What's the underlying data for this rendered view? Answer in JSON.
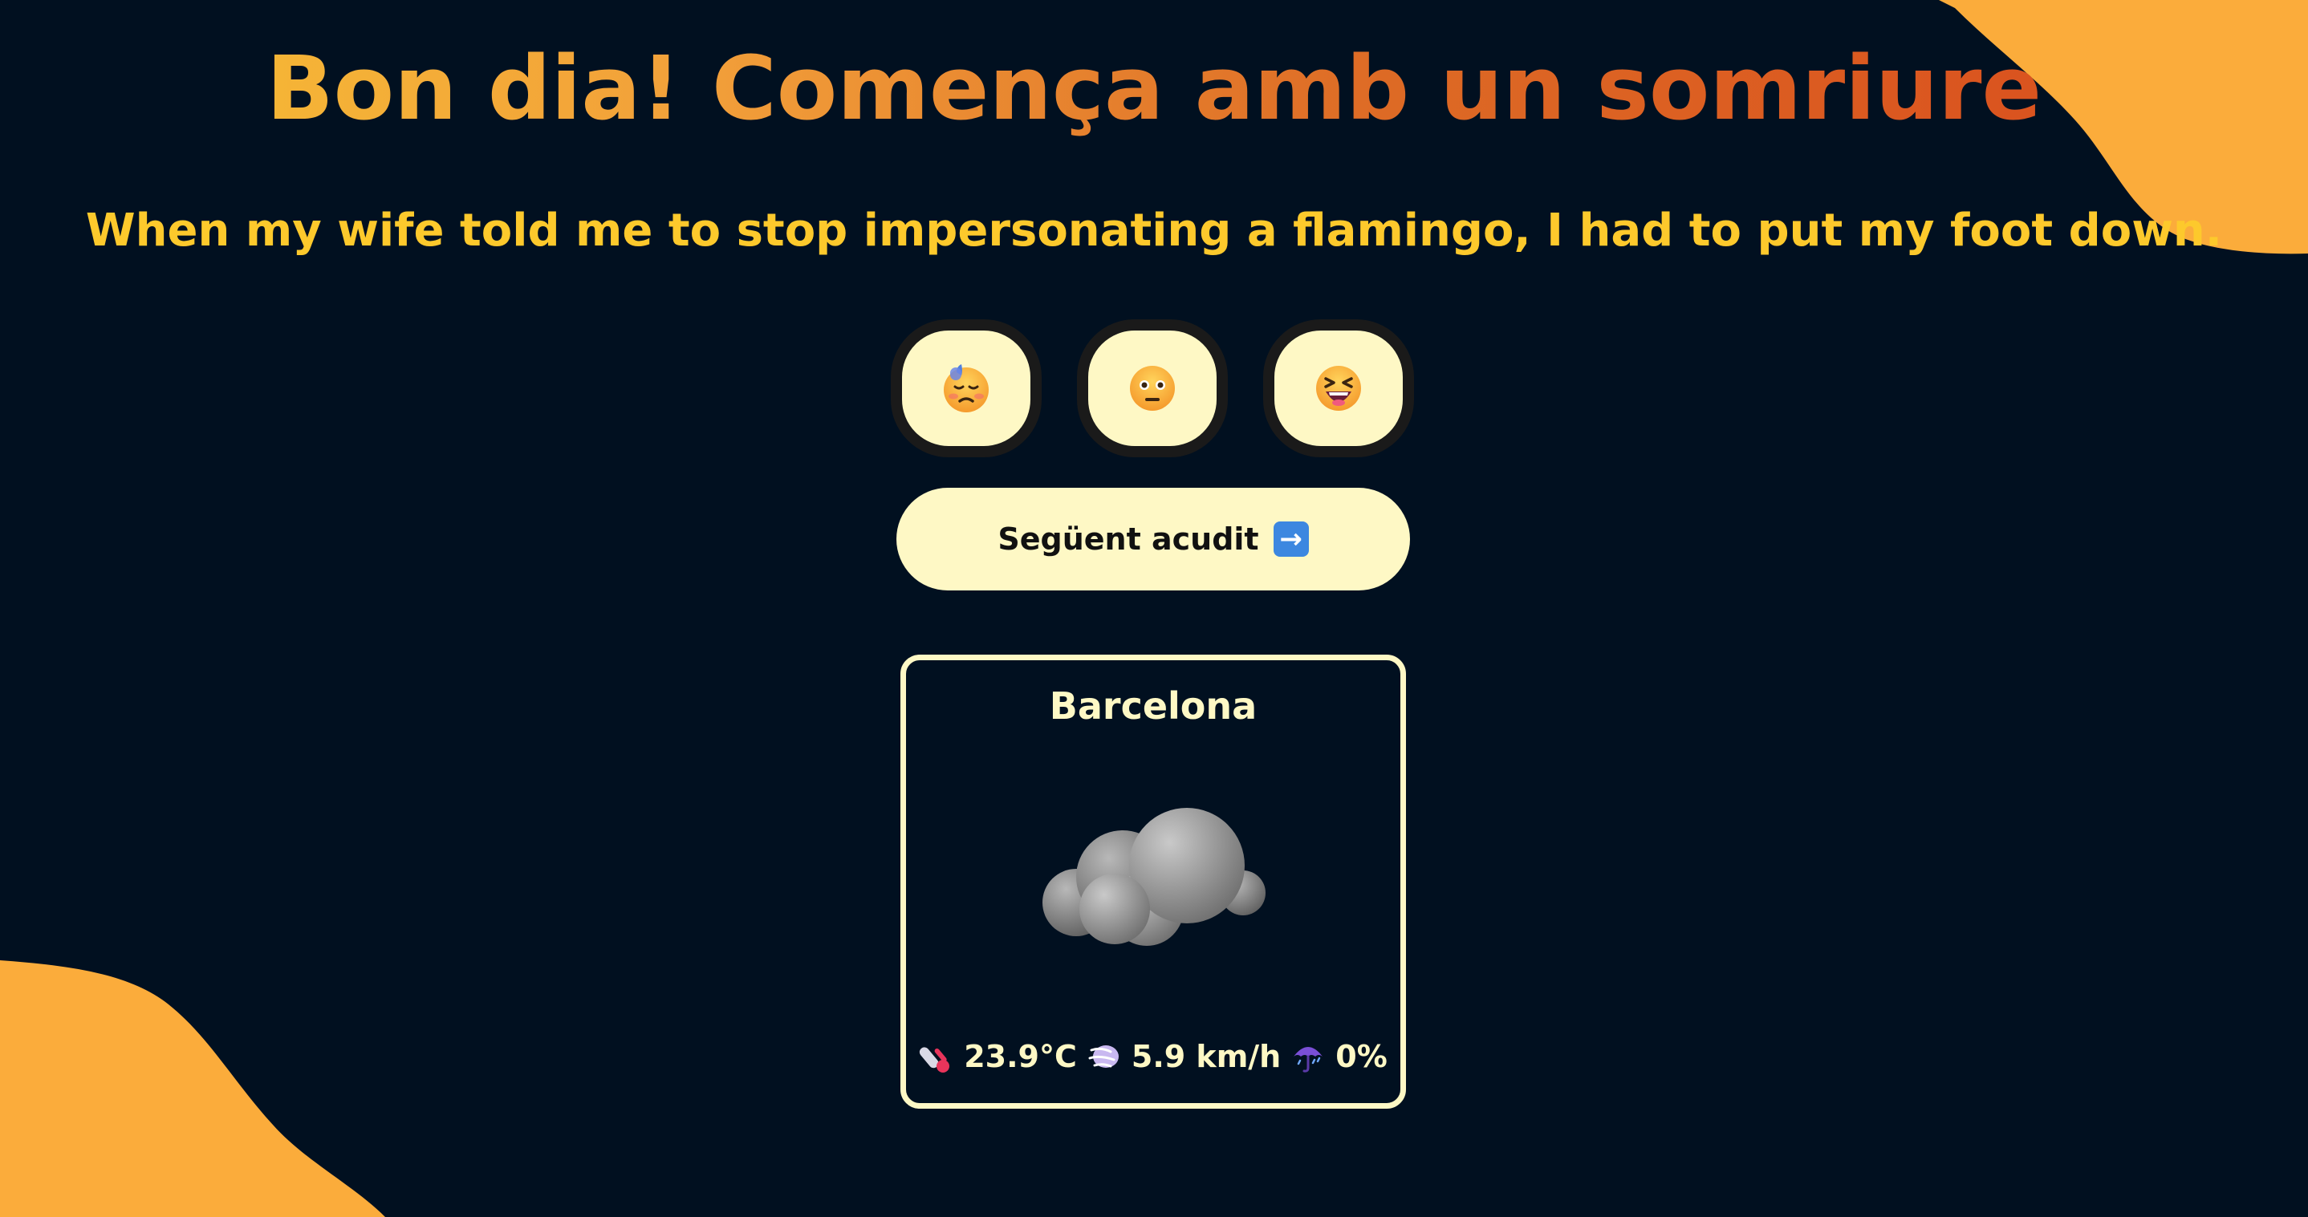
{
  "header": {
    "greeting": "Bon dia!",
    "tagline": "Comença amb un somriure"
  },
  "joke": {
    "text": "When my wife told me to stop impersonating a flamingo, I had to put my foot down."
  },
  "reactions": [
    {
      "icon": "downcast-sweat-face-icon"
    },
    {
      "icon": "neutral-face-icon"
    },
    {
      "icon": "laughing-face-icon"
    }
  ],
  "next_button": {
    "label": "Següent acudit",
    "icon": "right-arrow-icon"
  },
  "weather": {
    "city": "Barcelona",
    "condition_icon": "cloud-icon",
    "temperature": "23.9°C",
    "wind": "5.9 km/h",
    "precipitation": "0%"
  },
  "colors": {
    "background": "#011020",
    "accent_orange": "#fbac3b",
    "joke_yellow": "#fdc92c",
    "button_cream": "#fef8c5"
  }
}
